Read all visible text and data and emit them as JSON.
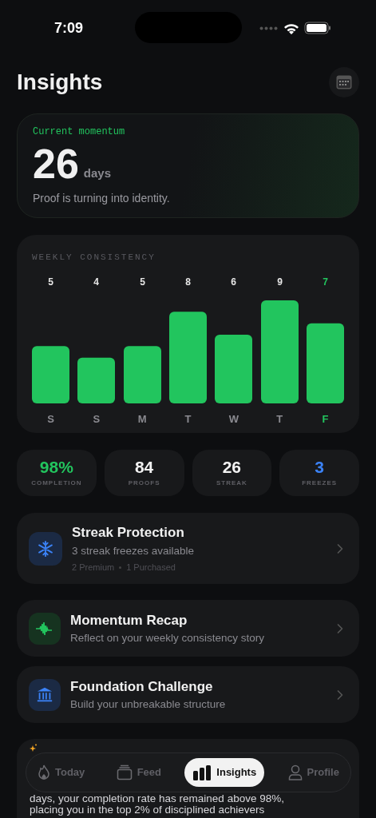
{
  "status_bar": {
    "time": "7:09"
  },
  "header": {
    "title": "Insights"
  },
  "momentum": {
    "label": "Current momentum",
    "value": "26",
    "unit": "days",
    "caption": "Proof is turning into identity."
  },
  "weekly": {
    "title": "WEEKLY CONSISTENCY",
    "today": [
      false,
      false,
      false,
      false,
      false,
      false,
      true
    ],
    "chart_data": {
      "type": "bar",
      "categories": [
        "S",
        "S",
        "M",
        "T",
        "W",
        "T",
        "F"
      ],
      "values": [
        5,
        4,
        5,
        8,
        6,
        9,
        7
      ],
      "data_labels": true
    }
  },
  "stats": [
    {
      "value": "98%",
      "label": "COMPLETION",
      "color": "#22c55e"
    },
    {
      "value": "84",
      "label": "PROOFS",
      "color": "#f2f2f2"
    },
    {
      "value": "26",
      "label": "STREAK",
      "color": "#f2f2f2"
    },
    {
      "value": "3",
      "label": "FREEZES",
      "color": "#3b82f6"
    }
  ],
  "rows": [
    {
      "kind": "snowflake",
      "title": "Streak Protection",
      "subtitle": "3 streak freezes available",
      "meta": [
        "2 Premium",
        "1 Purchased"
      ]
    },
    {
      "kind": "wave",
      "title": "Momentum Recap",
      "subtitle": "Reflect on your weekly consistency story"
    },
    {
      "kind": "pillars",
      "title": "Foundation Challenge",
      "subtitle": "Build your unbreakable structure"
    }
  ],
  "insight": {
    "lines": [
      "days, your completion rate has remained above 98%,",
      "placing you in the top 2% of disciplined achievers"
    ]
  },
  "tab_bar": [
    {
      "label": "Today",
      "kind": "flame",
      "selected": false
    },
    {
      "label": "Feed",
      "kind": "stack",
      "selected": false
    },
    {
      "label": "Insights",
      "kind": "bars",
      "selected": true
    },
    {
      "label": "Profile",
      "kind": "person",
      "selected": false
    }
  ]
}
